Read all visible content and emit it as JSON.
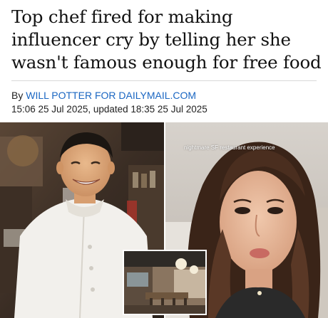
{
  "article": {
    "headline": "Top chef fired for making influencer cry by telling her she wasn't famous enough for free food",
    "byline_prefix": "By ",
    "author": "WILL POTTER FOR DAILYMAIL.COM",
    "dateline": "15:06 25 Jul 2025, updated 18:35 25 Jul 2025"
  },
  "photos": {
    "left_subject": "chef in white jacket",
    "right_subject": "influencer",
    "right_caption": "nightmare SF restaurant experience",
    "inset_subject": "restaurant interior"
  },
  "colors": {
    "link": "#1a66c2",
    "headline": "#111111",
    "rule": "#d8d8d8"
  }
}
